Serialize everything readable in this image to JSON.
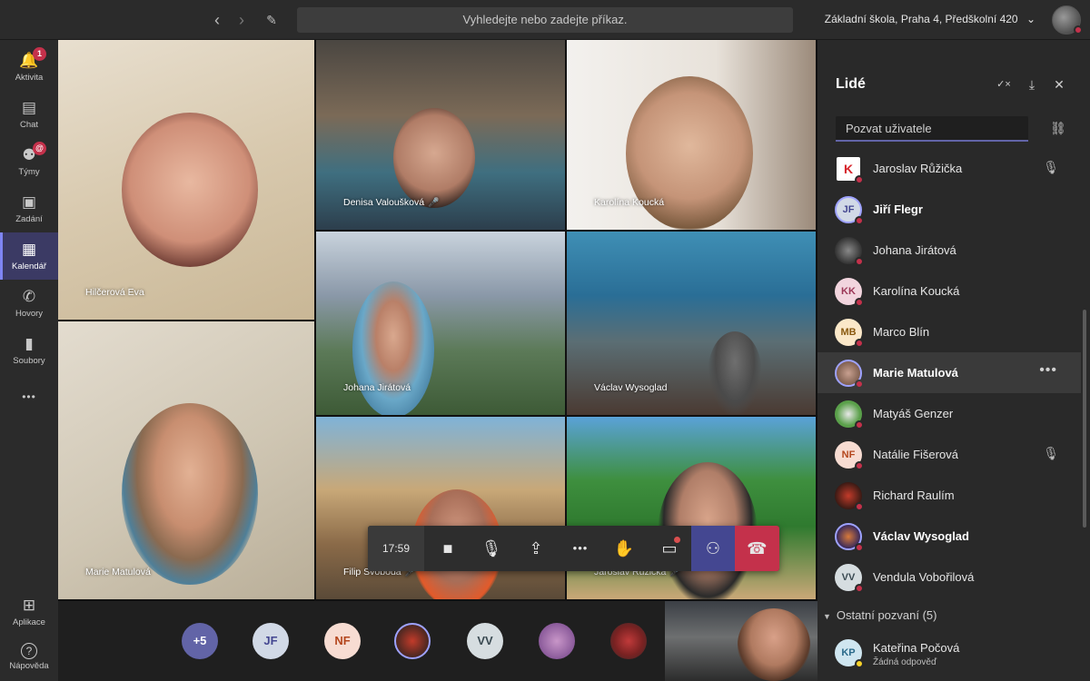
{
  "topbar": {
    "back": "‹",
    "forward": "›",
    "search_placeholder": "Vyhledejte nebo zadejte příkaz.",
    "org_name": "Základní škola, Praha 4, Předškolní 420",
    "org_chevron": "⌄"
  },
  "rail": {
    "items": [
      {
        "label": "Aktivita",
        "icon": "bell-icon",
        "glyph": "🔔",
        "badge": "1"
      },
      {
        "label": "Chat",
        "icon": "chat-icon",
        "glyph": "💬",
        "badge": ""
      },
      {
        "label": "Týmy",
        "icon": "teams-icon",
        "glyph": "👥",
        "badge": "@"
      },
      {
        "label": "Zadání",
        "icon": "assignments-icon",
        "glyph": "📋",
        "badge": ""
      },
      {
        "label": "Kalendář",
        "icon": "calendar-icon",
        "glyph": "▦",
        "badge": ""
      },
      {
        "label": "Hovory",
        "icon": "phone-icon",
        "glyph": "✆",
        "badge": ""
      },
      {
        "label": "Soubory",
        "icon": "files-icon",
        "glyph": "▮",
        "badge": ""
      },
      {
        "label": "",
        "icon": "more-icon",
        "glyph": "•••",
        "badge": ""
      }
    ],
    "apps_label": "Aplikace",
    "apps_glyph": "⊞",
    "help_label": "Nápověda",
    "help_glyph": "?"
  },
  "tiles": [
    {
      "name": "Hilčerová Eva"
    },
    {
      "name": "Denisa Valoušková",
      "mic": "🎤"
    },
    {
      "name": "Karolína Koucká"
    },
    {
      "name": "Johana Jirátová"
    },
    {
      "name": "Václav Wysoglad"
    },
    {
      "name": "Marie Matulová"
    },
    {
      "name": "Filip Svoboda",
      "mic": "🎤"
    },
    {
      "name": "Jaroslav Růžička",
      "mic": "🎤"
    }
  ],
  "controls": {
    "time": "17:59",
    "camera_glyph": "■",
    "mic_glyph": "🎙",
    "share_glyph": "⇪",
    "more_glyph": "•••",
    "raise_hand_glyph": "✋",
    "chat_glyph": "▭",
    "people_glyph": "⚇",
    "hangup_glyph": "☎"
  },
  "strip": {
    "pills": [
      {
        "text": "+5"
      },
      {
        "text": "JF"
      },
      {
        "text": "NF"
      },
      {
        "text": ""
      },
      {
        "text": "VV"
      },
      {
        "text": ""
      },
      {
        "text": ""
      }
    ]
  },
  "panel": {
    "title": "Lidé",
    "actions": {
      "mute_all": "✓×",
      "download": "⤓",
      "close": "✕"
    },
    "invite_placeholder": "Pozvat uživatele",
    "link_glyph": "⛓",
    "people": [
      {
        "name": "Jaroslav Růžička",
        "initials": "",
        "bold": false,
        "muted": true
      },
      {
        "name": "Jiří Flegr",
        "initials": "JF",
        "bold": true,
        "muted": false
      },
      {
        "name": "Johana Jirátová",
        "initials": "",
        "bold": false,
        "muted": false
      },
      {
        "name": "Karolína Koucká",
        "initials": "KK",
        "bold": false,
        "muted": false
      },
      {
        "name": "Marco Blín",
        "initials": "MB",
        "bold": false,
        "muted": false
      },
      {
        "name": "Marie Matulová",
        "initials": "",
        "bold": true,
        "muted": false
      },
      {
        "name": "Matyáš Genzer",
        "initials": "",
        "bold": false,
        "muted": false
      },
      {
        "name": "Natálie Fišerová",
        "initials": "NF",
        "bold": false,
        "muted": true
      },
      {
        "name": "Richard Raulím",
        "initials": "",
        "bold": false,
        "muted": false
      },
      {
        "name": "Václav Wysoglad",
        "initials": "",
        "bold": true,
        "muted": false
      },
      {
        "name": "Vendula Vobořilová",
        "initials": "VV",
        "bold": false,
        "muted": false
      }
    ],
    "row_more": "•••",
    "muted_glyph": "🎙",
    "others_label": "Ostatní pozvaní (5)",
    "others_chevron": "▼",
    "invited": {
      "name": "Kateřina Počová",
      "initials": "KP",
      "status": "Žádná odpověď"
    }
  }
}
